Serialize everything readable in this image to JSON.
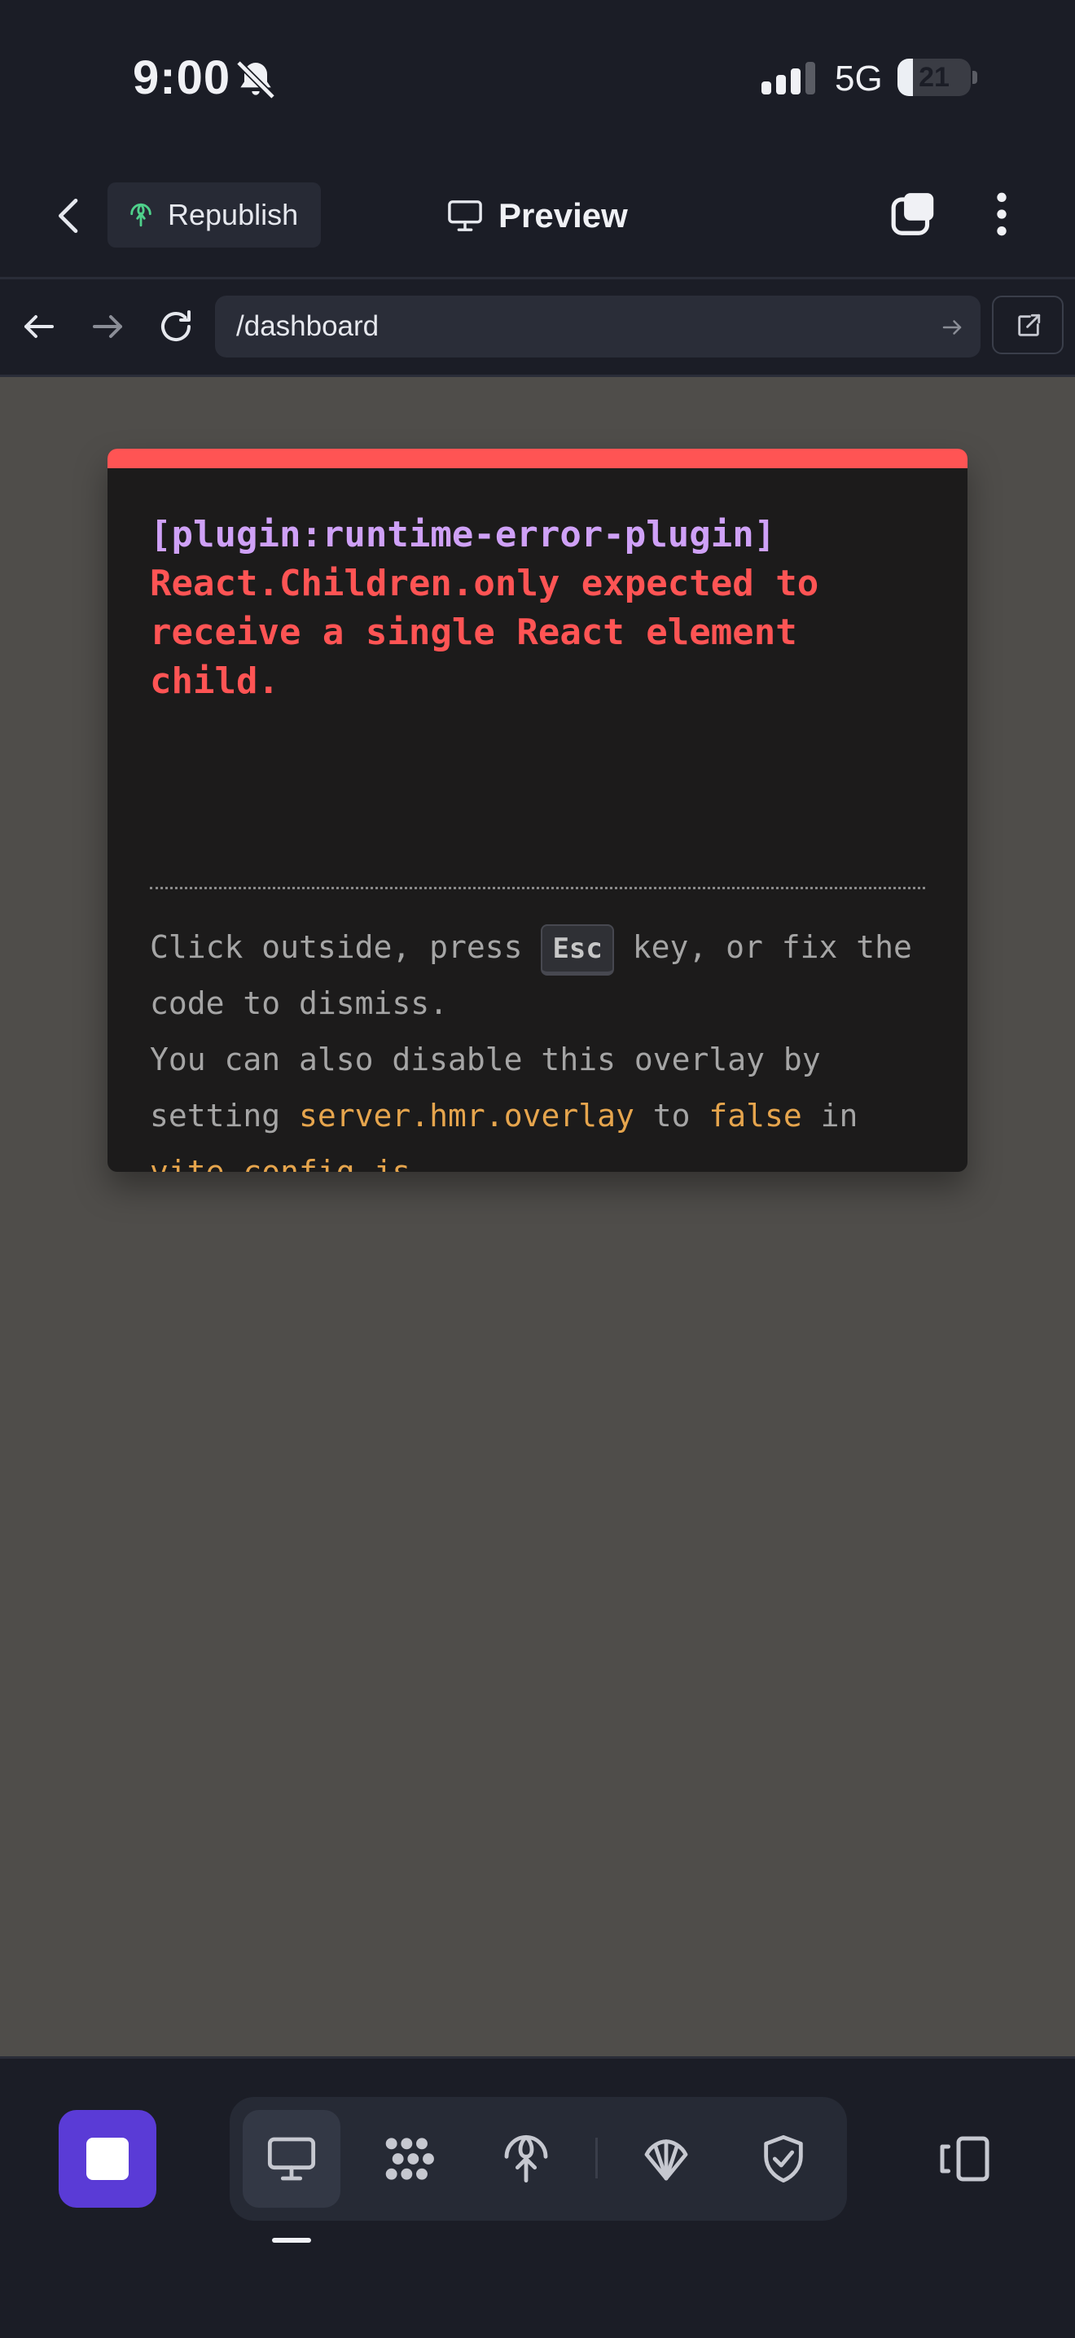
{
  "status_bar": {
    "time": "9:00",
    "network": "5G",
    "battery_percent": "21",
    "battery_level": 0.21,
    "icons": [
      "bell-muted-icon",
      "signal-icon"
    ]
  },
  "header": {
    "back_icon": "chevron-left-icon",
    "republish_label": "Republish",
    "republish_icon": "globe-icon",
    "preview_label": "Preview",
    "preview_icon": "monitor-icon",
    "tabs_icon": "tabs-icon",
    "more_icon": "more-vertical-icon"
  },
  "browser": {
    "url": "/dashboard",
    "icons": [
      "arrow-left-icon",
      "arrow-right-icon",
      "refresh-icon",
      "go-arrow-icon",
      "external-link-icon"
    ]
  },
  "error_overlay": {
    "plugin": "[plugin:runtime-error-plugin]",
    "message": "React.Children.only expected to receive a single React element child.",
    "tip_part1": "Click outside, press ",
    "tip_key": "Esc",
    "tip_part2": " key, or fix the code to dismiss.",
    "tip_line2_prefix": "You can also disable this overlay by setting ",
    "tip_setting": "server.hmr.overlay",
    "tip_to": " to ",
    "tip_value": "false",
    "tip_in": " in ",
    "tip_file": "vite.config.js",
    "tip_end": ".",
    "accent_color": "#ff5454",
    "plugin_color": "#cfa1f7",
    "code_color": "#e6a54d"
  },
  "bottom_bar": {
    "stop_icon": "stop-icon",
    "tools": [
      "monitor-icon",
      "dots-grid-icon",
      "deploy-icon",
      "shell-icon",
      "shield-check-icon"
    ],
    "active_tool": "monitor-icon",
    "panel_icon": "panel-toggle-icon",
    "accent_color": "#5a3bd6"
  }
}
